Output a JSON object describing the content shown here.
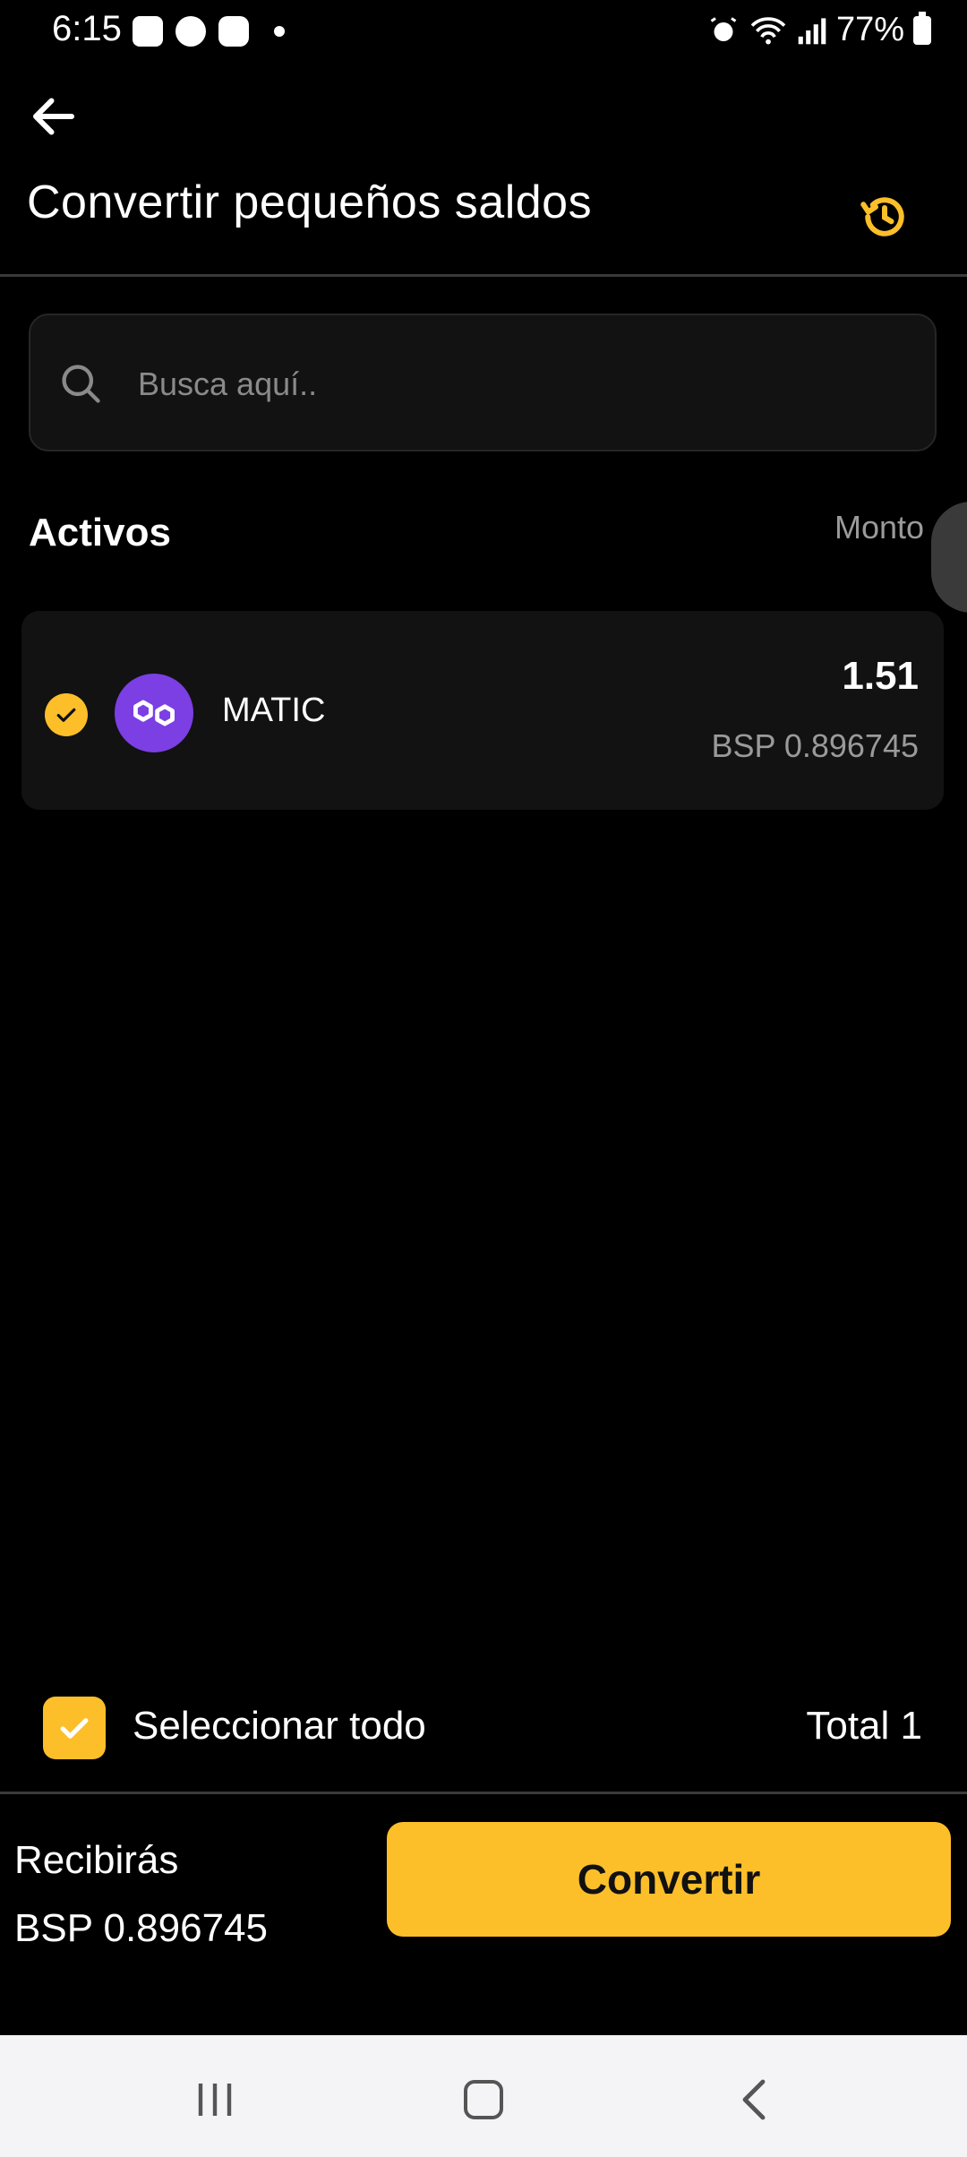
{
  "status_bar": {
    "time": "6:15",
    "battery": "77%"
  },
  "header": {
    "title": "Convertir pequeños saldos"
  },
  "search": {
    "placeholder": "Busca aquí.."
  },
  "list_header": {
    "title": "Activos",
    "amount_label": "Monto"
  },
  "assets": [
    {
      "symbol": "MATIC",
      "amount": "1.51",
      "value": "BSP 0.896745",
      "selected": true
    }
  ],
  "footer": {
    "select_all_label": "Seleccionar todo",
    "total_label": "Total 1",
    "receive_label": "Recibirás",
    "receive_value": "BSP 0.896745",
    "convert_label": "Convertir"
  },
  "colors": {
    "accent": "#fcbf2a",
    "background": "#000000",
    "card": "#121212",
    "token_polygon": "#7b3fe4",
    "muted_text": "#9a9a9a"
  },
  "icons": {
    "back": "arrow-left-icon",
    "history": "history-icon",
    "search": "search-icon",
    "check": "check-icon",
    "token": "polygon-icon"
  }
}
